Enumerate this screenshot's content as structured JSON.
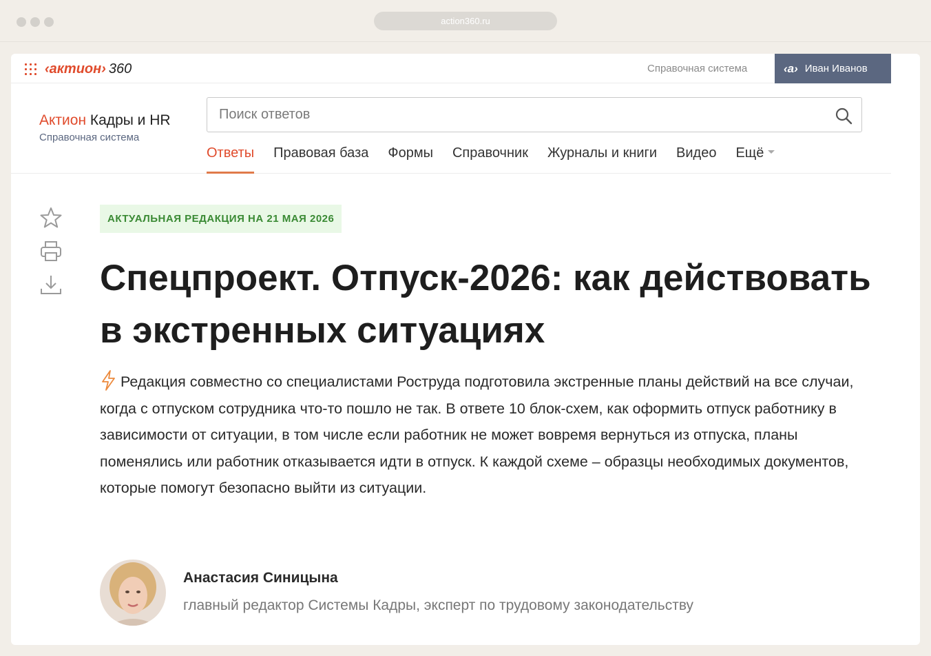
{
  "browser": {
    "url": "action360.ru"
  },
  "topbar": {
    "brand_name": "‹актион›",
    "brand_number": "360",
    "system_link": "Справочная система",
    "user_logo": "‹а›",
    "user_name": "Иван Иванов"
  },
  "header": {
    "product_accent": "Актион",
    "product_name": " Кадры и HR",
    "product_subtitle": "Справочная система",
    "search_placeholder": "Поиск ответов"
  },
  "nav": {
    "items": [
      {
        "label": "Ответы",
        "active": true
      },
      {
        "label": "Правовая база"
      },
      {
        "label": "Формы"
      },
      {
        "label": "Справочник"
      },
      {
        "label": "Журналы и книги"
      },
      {
        "label": "Видео"
      },
      {
        "label": "Ещё"
      }
    ]
  },
  "side_tools": [
    "star-icon",
    "print-icon",
    "download-icon"
  ],
  "article": {
    "badge": "АКТУАЛЬНАЯ РЕДАКЦИЯ НА 21 МАЯ 2026",
    "title": "Спецпроект. Отпуск-2026: как действовать в экстренных ситуациях",
    "lead": "Редакция совместно со специалистами Роструда подготовила экстренные планы действий на все случаи, когда с отпуском сотрудника что-то пошло не так.  В ответе 10 блок-схем, как оформить отпуск работнику в зависимости от ситуации, в том числе если работник не может вовремя вернуться из отпуска, планы поменялись или работник отказывается идти в отпуск. К каждой схеме – образцы необходимых документов, которые помогут безопасно выйти из ситуации."
  },
  "author": {
    "name": "Анастасия Синицына",
    "role": "главный редактор Системы Кадры, эксперт по трудовому законодательству"
  },
  "colors": {
    "accent": "#e04b2c",
    "nav_underline": "#e07a4a",
    "user_box": "#5b6780",
    "badge_bg": "#e9f8e6",
    "badge_text": "#3a8a34"
  }
}
